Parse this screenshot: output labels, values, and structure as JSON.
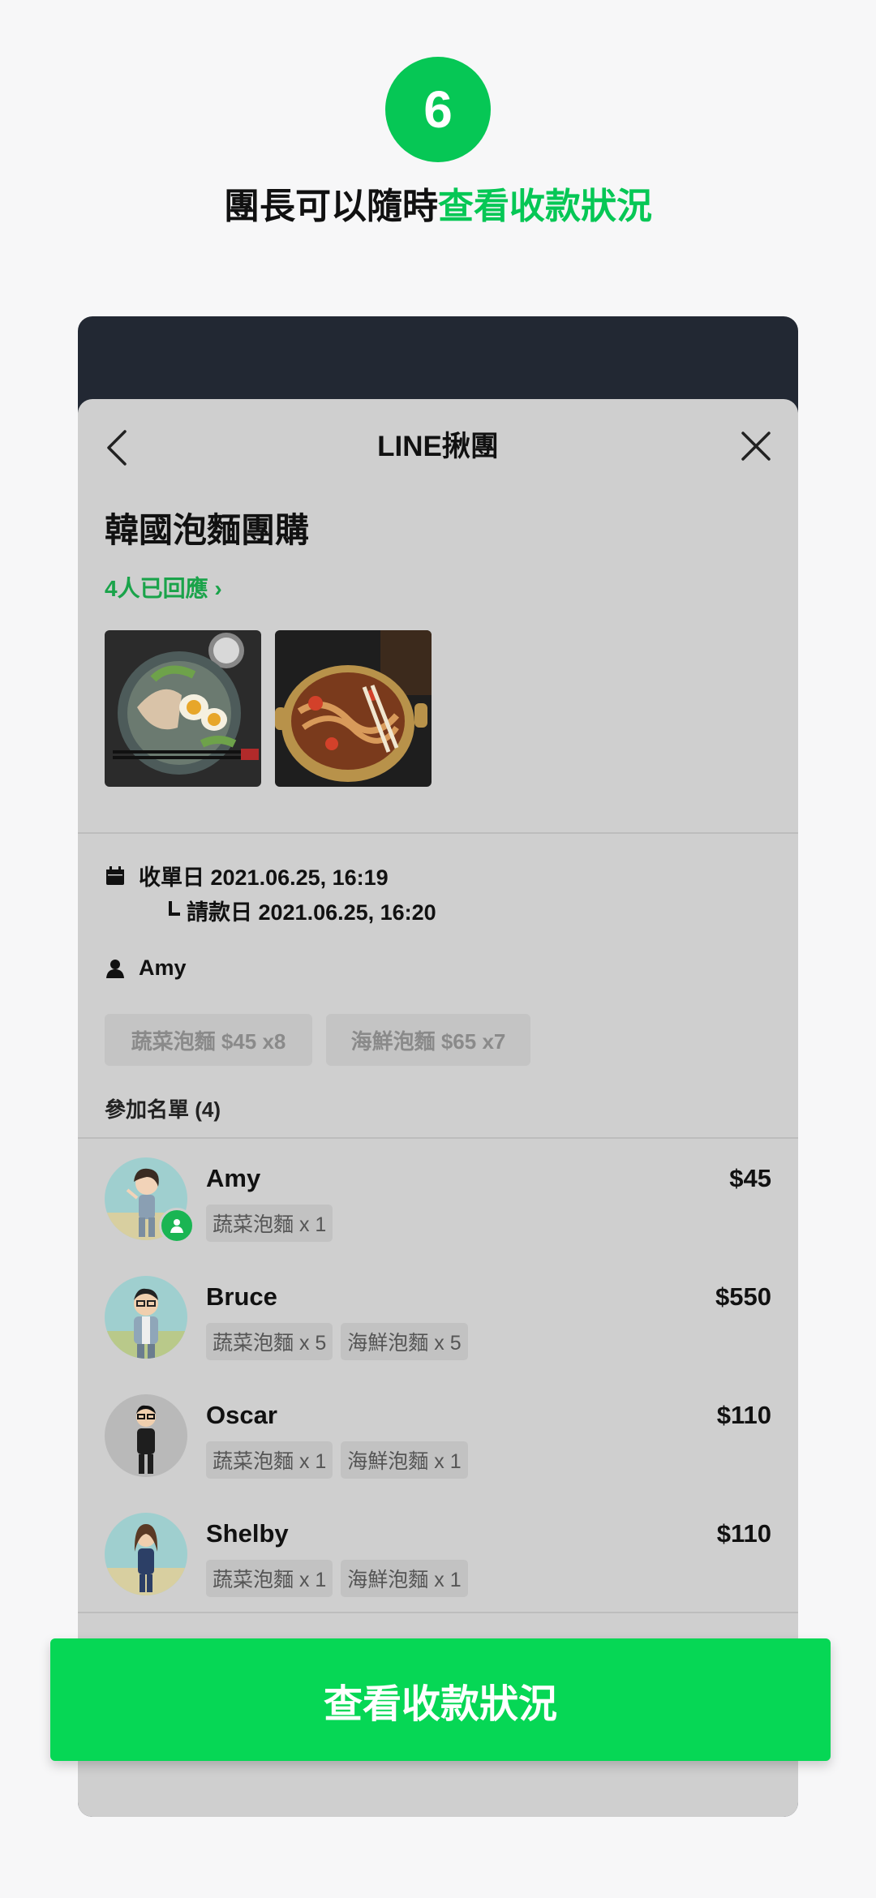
{
  "step": {
    "number": "6"
  },
  "headline": {
    "prefix": "團長可以隨時",
    "highlight": "查看收款狀況"
  },
  "nav": {
    "title": "LINE揪團",
    "back_icon": "chevron-left-icon",
    "close_icon": "close-icon"
  },
  "post": {
    "title": "韓國泡麵團購",
    "responses": "4人已回應 ›"
  },
  "photos": [
    {
      "alt": "韓式泡麵配雞肉與蛋"
    },
    {
      "alt": "鍋煮辣泡麵"
    }
  ],
  "info": {
    "close_date": "收單日 2021.06.25, 16:19",
    "payment_date": "請款日 2021.06.25, 16:20",
    "organizer": "Amy"
  },
  "options": [
    {
      "label": "蔬菜泡麵 $45 x8"
    },
    {
      "label": "海鮮泡麵 $65 x7"
    }
  ],
  "participants_label": "參加名單 (4)",
  "participants": [
    {
      "name": "Amy",
      "amount": "$45",
      "items": [
        "蔬菜泡麵 x 1"
      ]
    },
    {
      "name": "Bruce",
      "amount": "$550",
      "items": [
        "蔬菜泡麵 x 5",
        "海鮮泡麵 x 5"
      ]
    },
    {
      "name": "Oscar",
      "amount": "$110",
      "items": [
        "蔬菜泡麵 x 1",
        "海鮮泡麵 x 1"
      ]
    },
    {
      "name": "Shelby",
      "amount": "$110",
      "items": [
        "蔬菜泡麵 x 1",
        "海鮮泡麵 x 1"
      ]
    }
  ],
  "cta": {
    "label": "查看收款狀況"
  },
  "colors": {
    "accent": "#06c755",
    "cta": "#06d755",
    "link": "#1aa34a",
    "header_dark": "#222833",
    "sheet": "#cfcfcf"
  }
}
